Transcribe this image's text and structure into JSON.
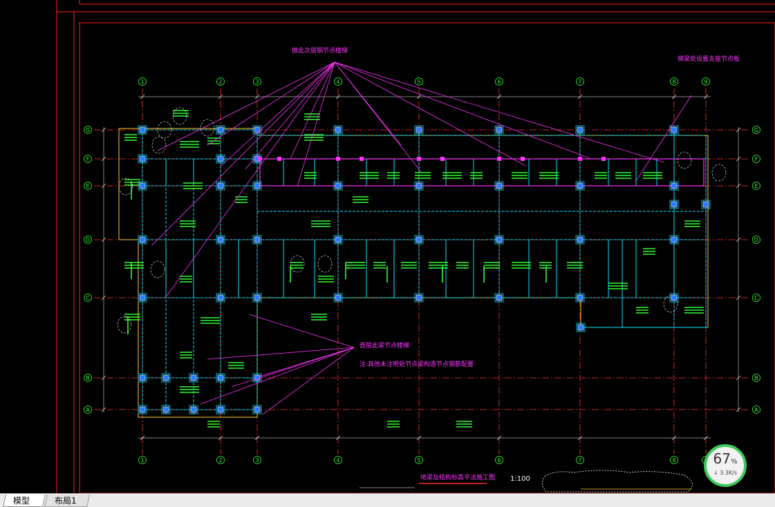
{
  "drawing": {
    "axis_numbers": [
      "1",
      "2",
      "3",
      "4",
      "5",
      "6",
      "7",
      "8",
      "9"
    ],
    "axis_letters": [
      "A",
      "B",
      "C",
      "D",
      "E",
      "F",
      "G"
    ],
    "annotations": {
      "top_center": "做此次层钢节点楼梯",
      "top_right": "梯梁处设置支座节点板",
      "middle": "首层此梁节点楼梯",
      "note": "注:其他未注明处节点梁构造节点钢筋配置"
    },
    "title": "地梁及结构标高平法施工图",
    "scale": "1:100"
  },
  "network_widget": {
    "percent": "67",
    "percent_unit": "%",
    "speed": "↓ 3.3K/s"
  },
  "tabs": {
    "model": "模型",
    "layout": "布局1"
  },
  "colors": {
    "background": "#000000",
    "frame": "#ff2020",
    "axis_line": "#ff3030",
    "beam": "#00e5ff",
    "text_green": "#33ff33",
    "annotation": "#ff33ff",
    "column": "#2a7bff",
    "outline": "#ffcc33",
    "widget_ring": "#3cc85a"
  }
}
